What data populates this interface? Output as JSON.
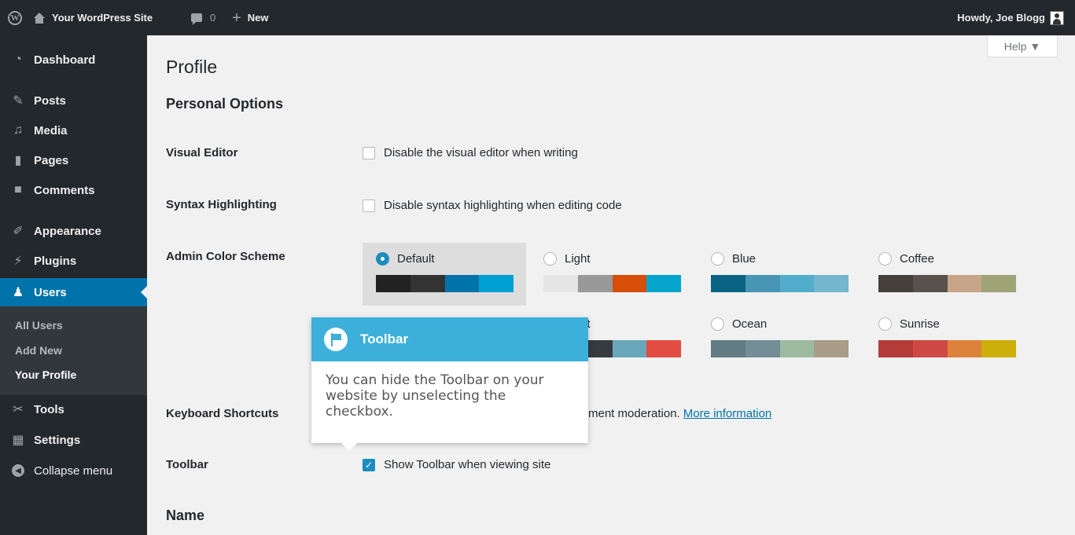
{
  "adminbar": {
    "site_name": "Your WordPress Site",
    "comments_count": "0",
    "new_label": "New",
    "howdy": "Howdy, Joe Blogg"
  },
  "sidebar": {
    "items": [
      {
        "label": "Dashboard",
        "icon": "dashboard-icon"
      },
      {
        "label": "Posts",
        "icon": "pin-icon"
      },
      {
        "label": "Media",
        "icon": "media-icon"
      },
      {
        "label": "Pages",
        "icon": "pages-icon"
      },
      {
        "label": "Comments",
        "icon": "comment-icon"
      },
      {
        "label": "Appearance",
        "icon": "brush-icon"
      },
      {
        "label": "Plugins",
        "icon": "plugin-icon"
      },
      {
        "label": "Users",
        "icon": "users-icon"
      },
      {
        "label": "Tools",
        "icon": "wrench-icon"
      },
      {
        "label": "Settings",
        "icon": "settings-icon"
      },
      {
        "label": "Collapse menu",
        "icon": "collapse-icon"
      }
    ],
    "submenu": [
      "All Users",
      "Add New",
      "Your Profile"
    ]
  },
  "help_label": "Help ▼",
  "page_title": "Profile",
  "personal_options_title": "Personal Options",
  "visual_editor": {
    "label": "Visual Editor",
    "option": "Disable the visual editor when writing"
  },
  "syntax": {
    "label": "Syntax Highlighting",
    "option": "Disable syntax highlighting when editing code"
  },
  "color_scheme": {
    "label": "Admin Color Scheme",
    "schemes": [
      {
        "name": "Default",
        "selected": true,
        "colors": [
          "#222222",
          "#333333",
          "#0073aa",
          "#00a0d2"
        ]
      },
      {
        "name": "Light",
        "selected": false,
        "colors": [
          "#e5e5e5",
          "#999999",
          "#d64e07",
          "#04a4cc"
        ]
      },
      {
        "name": "Blue",
        "selected": false,
        "colors": [
          "#096484",
          "#4796b3",
          "#52accc",
          "#74b6ce"
        ]
      },
      {
        "name": "Coffee",
        "selected": false,
        "colors": [
          "#46403c",
          "#59524c",
          "#c7a589",
          "#9ea476"
        ]
      },
      {
        "name": "Midnight",
        "visible_name": "night",
        "selected": false,
        "colors": [
          "#25282b",
          "#363b3f",
          "#69a8bb",
          "#e14d43"
        ]
      },
      {
        "name": "Ocean",
        "selected": false,
        "colors": [
          "#627c83",
          "#738e96",
          "#9ebaa0",
          "#aa9d88"
        ]
      },
      {
        "name": "Sunrise",
        "selected": false,
        "colors": [
          "#b43c38",
          "#cf4944",
          "#dd823b",
          "#ccaf0b"
        ]
      }
    ]
  },
  "keyboard": {
    "label": "Keyboard Shortcuts",
    "visible_text": "ment moderation.",
    "link": "More information"
  },
  "toolbar_row": {
    "label": "Toolbar",
    "option": "Show Toolbar when viewing site",
    "checked": true
  },
  "name_title": "Name",
  "tooltip": {
    "title": "Toolbar",
    "body": "You can hide the Toolbar on your website by unselecting the checkbox."
  }
}
